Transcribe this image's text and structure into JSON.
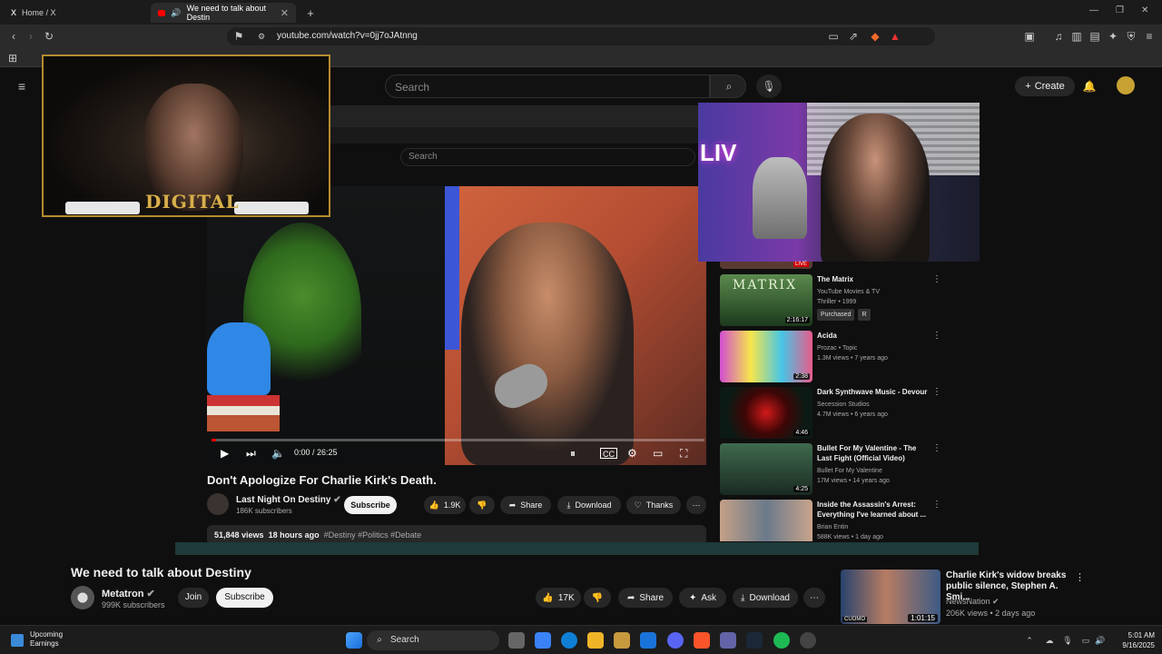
{
  "browser": {
    "tabs": [
      {
        "label": "Home / X"
      },
      {
        "label": "We need to talk about Destin"
      }
    ],
    "url": "youtube.com/watch?v=0jj7oJAtnng"
  },
  "youtube": {
    "search_placeholder": "Search",
    "create_label": "Create"
  },
  "inner_screen": {
    "search_placeholder": "Search",
    "player": {
      "time": "0:00 / 26:25",
      "progress_fraction": 0.0
    },
    "video": {
      "title": "Don't Apologize For Charlie Kirk's Death.",
      "channel": "Last Night On Destiny",
      "subscribers": "186K subscribers",
      "subscribe_label": "Subscribe",
      "likes": "1.9K",
      "share_label": "Share",
      "download_label": "Download",
      "thanks_label": "Thanks",
      "views": "51,848 views",
      "age": "18 hours ago",
      "tags": "#Destiny #Politics #Debate"
    },
    "live_label": "LIVE",
    "recommendations": [
      {
        "title": "The Matrix",
        "meta1": "YouTube Movies & TV",
        "meta2": "Thriller • 1999",
        "badge1": "Purchased",
        "badge2": "R",
        "duration": "2:16:17"
      },
      {
        "title": "Acida",
        "meta1": "Prozac • Topic",
        "meta2": "1.3M views • 7 years ago",
        "duration": "2:38"
      },
      {
        "title": "Dark Synthwave Music - Devour",
        "meta1": "Secession Studios",
        "meta2": "4.7M views • 6 years ago",
        "duration": "4:46"
      },
      {
        "title": "Bullet For My Valentine - The Last Fight (Official Video)",
        "meta1": "Bullet For My Valentine",
        "meta2": "17M views • 14 years ago",
        "duration": "4:25"
      },
      {
        "title": "Inside the Assassin's Arrest: Everything I've learned about ...",
        "meta1": "Brian Entin",
        "meta2": "588K views • 1 day ago",
        "duration": ""
      }
    ]
  },
  "webcam_overlay_brand": "DIGITAL",
  "neon_sign": "LIV",
  "outer": {
    "title": "We need to talk about Destiny",
    "channel": "Metatron",
    "subscribers": "999K subscribers",
    "join_label": "Join",
    "subscribe_label": "Subscribe",
    "likes": "17K",
    "share_label": "Share",
    "ask_label": "Ask",
    "download_label": "Download",
    "side_rec": {
      "title": "Charlie Kirk's widow breaks public silence, Stephen A. Smi...",
      "channel": "NewsNation",
      "meta": "206K views • 2 days ago",
      "duration": "1:01:15",
      "thumb_text": "CUOMO"
    }
  },
  "taskbar": {
    "weather_title": "Upcoming",
    "weather_sub": "Earnings",
    "search_label": "Search",
    "time": "5:01 AM",
    "date": "9/16/2025"
  }
}
